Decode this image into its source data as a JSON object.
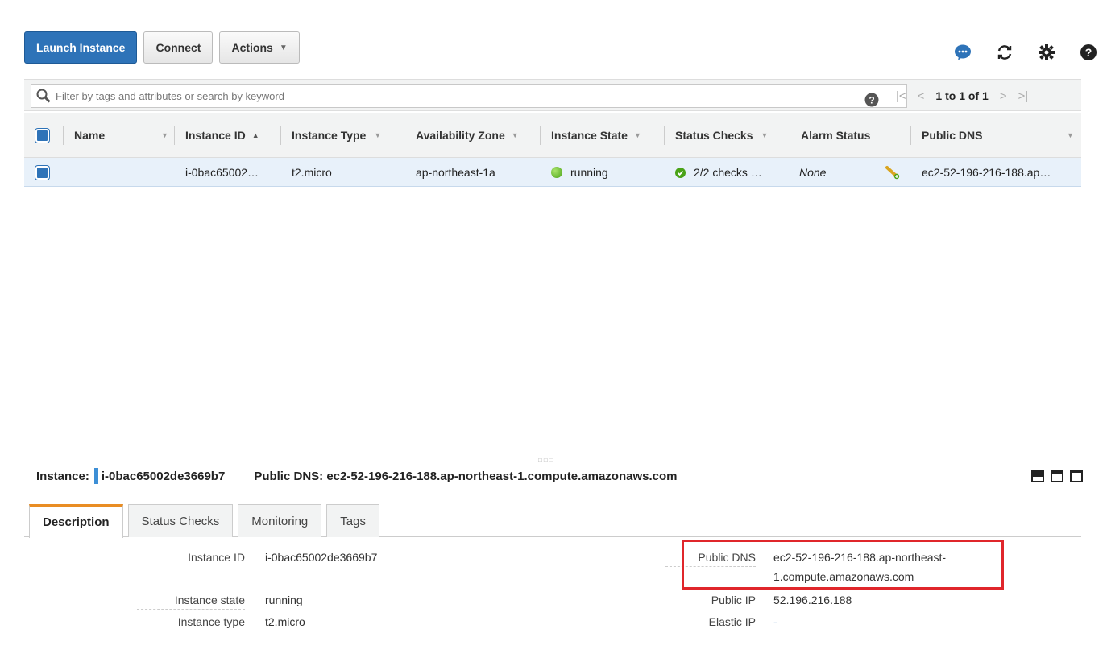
{
  "toolbar": {
    "launch_label": "Launch Instance",
    "connect_label": "Connect",
    "actions_label": "Actions"
  },
  "top_icons": [
    "chat-icon",
    "refresh-icon",
    "gear-icon",
    "help-icon"
  ],
  "search": {
    "placeholder": "Filter by tags and attributes or search by keyword",
    "pager_text": "1 to 1 of 1"
  },
  "table": {
    "columns": [
      "Name",
      "Instance ID",
      "Instance Type",
      "Availability Zone",
      "Instance State",
      "Status Checks",
      "Alarm Status",
      "Public DNS"
    ],
    "rows": [
      {
        "name": "",
        "instance_id": "i-0bac65002…",
        "instance_type": "t2.micro",
        "availability_zone": "ap-northeast-1a",
        "instance_state": "running",
        "status_checks": "2/2 checks …",
        "alarm_status": "None",
        "public_dns": "ec2-52-196-216-188.ap…"
      }
    ]
  },
  "pane": {
    "instance_label": "Instance:",
    "instance_id": "i-0bac65002de3669b7",
    "public_dns_label": "Public DNS: ec2-52-196-216-188.ap-northeast-1.compute.amazonaws.com",
    "tabs": [
      "Description",
      "Status Checks",
      "Monitoring",
      "Tags"
    ],
    "details_left": [
      {
        "label": "Instance ID",
        "value": "i-0bac65002de3669b7"
      },
      {
        "label": "Instance state",
        "value": "running"
      },
      {
        "label": "Instance type",
        "value": "t2.micro"
      }
    ],
    "details_right": [
      {
        "label": "Public DNS",
        "value_line1": "ec2-52-196-216-188.ap-northeast-",
        "value_line2": "1.compute.amazonaws.com"
      },
      {
        "label": "Public IP",
        "value": "52.196.216.188"
      },
      {
        "label": "Elastic IP",
        "value": "-"
      }
    ]
  },
  "colors": {
    "primary": "#2e73b8",
    "highlight": "#e0262b",
    "active_tab": "#e98d23"
  }
}
